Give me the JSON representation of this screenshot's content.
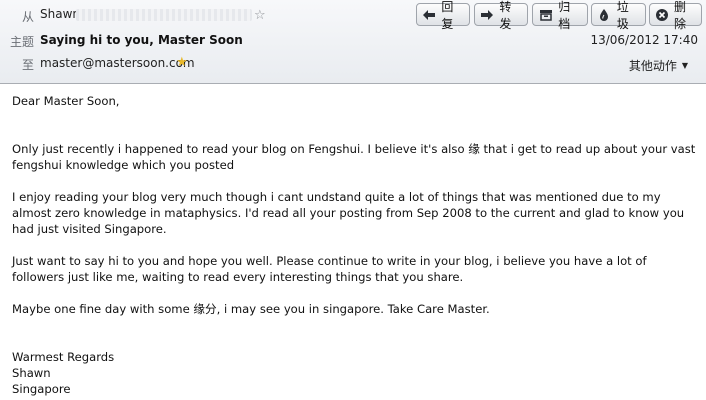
{
  "header": {
    "from_label": "从",
    "from_name": "Shawn",
    "subject_label": "主题",
    "subject": "Saying hi to you, Master Soon",
    "to_label": "至",
    "to_address": "master@mastersoon.com",
    "date": "13/06/2012 17:40",
    "other_actions": "其他动作"
  },
  "toolbar": {
    "reply": "回复",
    "forward": "转发",
    "archive": "归档",
    "junk": "垃圾",
    "delete": "删除"
  },
  "icons": [
    "star-icon",
    "reply-icon",
    "forward-icon",
    "archive-icon",
    "junk-icon",
    "delete-icon",
    "chevron-down-icon"
  ],
  "message": {
    "greeting": "Dear Master Soon,",
    "para1": "Only just recently i happened to read your blog on Fengshui. I believe it's also 缘 that i get to read up about your vast fengshui knowledge which you posted",
    "para2": "I enjoy reading your blog very much though i cant undstand quite a lot of things that was mentioned due to my almost zero knowledge in mataphysics. I'd read all your posting from Sep 2008 to the current and glad to know you had just visited Singapore.",
    "para3": "Just want to say hi to you and hope you well. Please continue to write in your blog, i believe you have a lot of followers just like me, waiting to read every interesting things that you share.",
    "para4": "Maybe one fine day with some 缘分, i may see you in singapore. Take Care Master.",
    "signoff": "Warmest Regards",
    "sign_name": "Shawn",
    "sign_place": "Singapore"
  }
}
